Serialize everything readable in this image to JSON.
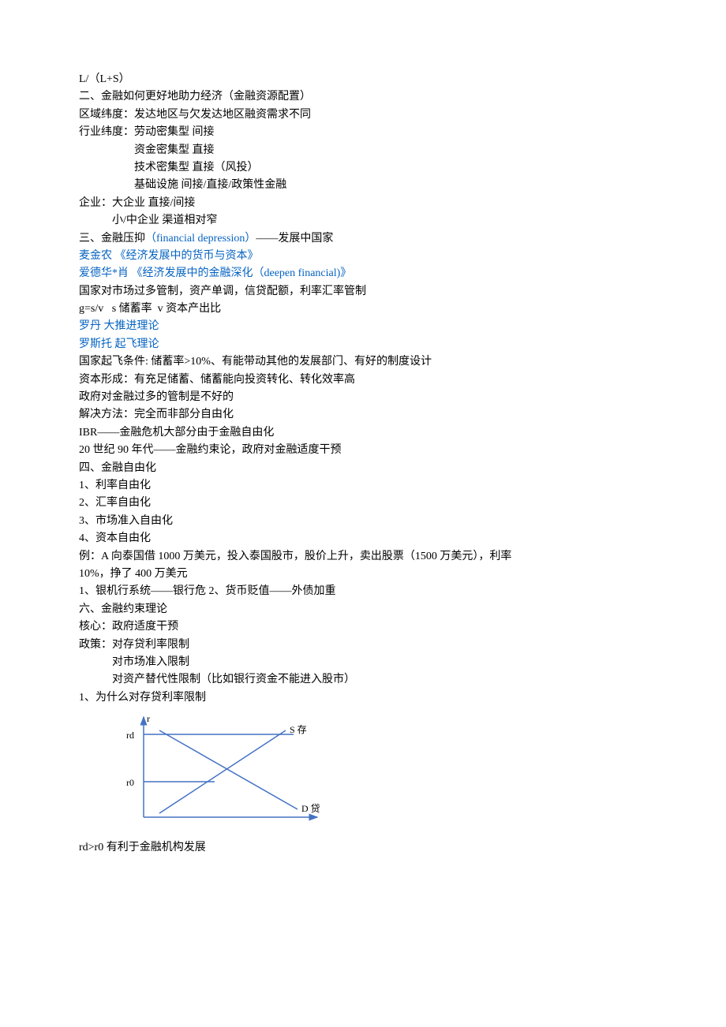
{
  "lines": {
    "l1": "L/（L+S）",
    "l2": "二、金融如何更好地助力经济（金融资源配置）",
    "l3": "区域纬度：发达地区与欠发达地区融资需求不同",
    "l4": "行业纬度：劳动密集型 间接",
    "l5": "资金密集型 直接",
    "l6": "技术密集型 直接（风投）",
    "l7": "基础设施 间接/直接/政策性金融",
    "l8": "企业：大企业 直接/间接",
    "l9": "小/中企业 渠道相对窄",
    "l10a": "三、金融压抑",
    "l10b": "（financial depression）",
    "l10c": "——发展中国家",
    "l11": "麦金农 《经济发展中的货币与资本》",
    "l12": "爱德华*肖 《经济发展中的金融深化（deepen financial)》",
    "l13": "国家对市场过多管制，资产单调，信贷配额，利率汇率管制",
    "l14": "g=s/v   s 储蓄率  v 资本产出比",
    "l15": "罗丹 大推进理论",
    "l16": "罗斯托 起飞理论",
    "l17": "国家起飞条件: 储蓄率>10%、有能带动其他的发展部门、有好的制度设计",
    "l18": "资本形成：有充足储蓄、储蓄能向投资转化、转化效率高",
    "l19": "政府对金融过多的管制是不好的",
    "l20": "解决方法：完全而非部分自由化",
    "l21": "IBR——金融危机大部分由于金融自由化",
    "l22": "20 世纪 90 年代——金融约束论，政府对金融适度干预",
    "l23": "四、金融自由化",
    "l24": "1、利率自由化",
    "l25": "2、汇率自由化",
    "l26": "3、市场准入自由化",
    "l27": "4、资本自由化",
    "l28": "例：A 向泰国借 1000 万美元，投入泰国股市，股价上升，卖出股票（1500 万美元），利率",
    "l29": "10%，挣了 400 万美元",
    "l30": "1、银机行系统——银行危 2、货币贬值——外债加重",
    "l31": "六、金融约束理论",
    "l32": "核心：政府适度干预",
    "l33": "政策：对存贷利率限制",
    "l34": "对市场准入限制",
    "l35": "对资产替代性限制（比如银行资金不能进入股市）",
    "l36": "1、为什么对存贷利率限制",
    "l37": "rd>r0 有利于金融机构发展"
  },
  "chart_data": {
    "type": "line",
    "title": "",
    "xlabel": "",
    "ylabel": "r",
    "y_axis_labels": [
      "rd",
      "r0"
    ],
    "series": [
      {
        "name": "S 存",
        "description": "Savings supply curve, upward sloping"
      },
      {
        "name": "D 贷",
        "description": "Loan demand curve, downward sloping"
      }
    ],
    "annotations": {
      "rd_label": "rd",
      "r0_label": "r0",
      "r_axis": "r",
      "s_label": "S 存",
      "d_label": "D 贷"
    },
    "legend_position": "right"
  }
}
